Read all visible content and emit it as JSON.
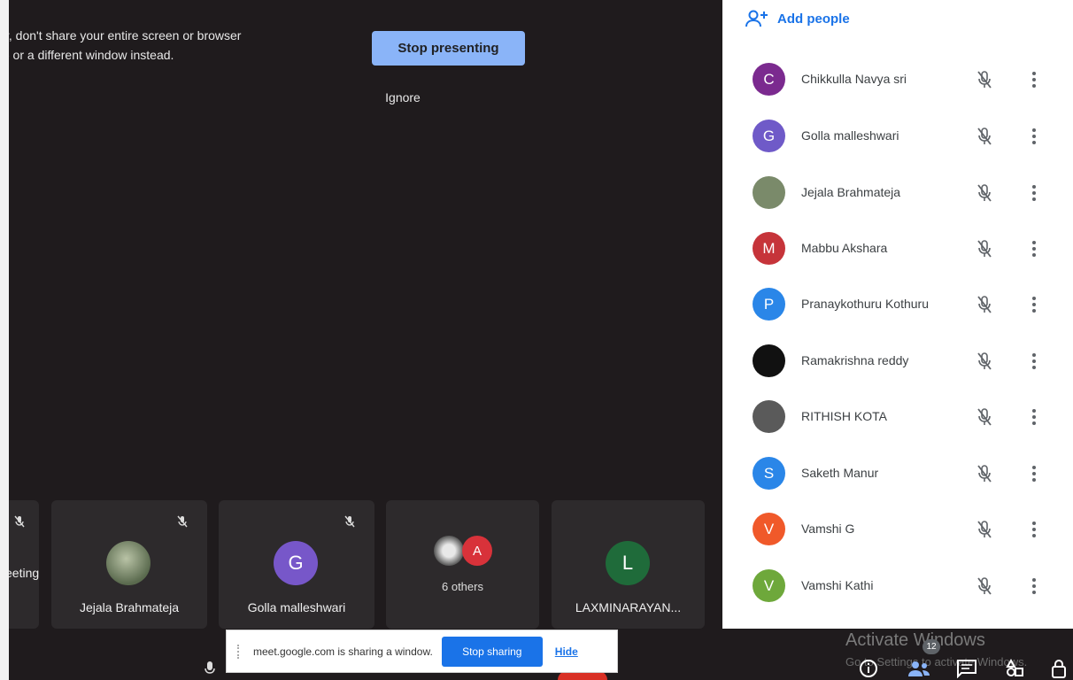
{
  "stage": {
    "warning_line1": "r, don't share your entire screen or browser",
    "warning_line2": "- or a different window instead.",
    "stop_presenting": "Stop presenting",
    "ignore": "Ignore"
  },
  "tiles": [
    {
      "name": "eeting"
    },
    {
      "name": "Jejala Brahmateja"
    },
    {
      "name": "Golla malleshwari",
      "initial": "G"
    },
    {
      "name": "6 others",
      "initial": "A"
    },
    {
      "name": "LAXMINARAYAN...",
      "initial": "L"
    }
  ],
  "share_bar": {
    "text": "meet.google.com is sharing a window.",
    "stop_sharing": "Stop sharing",
    "hide": "Hide"
  },
  "panel": {
    "add_people": "Add people",
    "people": [
      {
        "name": "Chikkulla Navya sri",
        "initial": "C",
        "color": "#7b2a8f"
      },
      {
        "name": "Golla malleshwari",
        "initial": "G",
        "color": "#6f5ac8"
      },
      {
        "name": "Jejala Brahmateja",
        "initial": "",
        "color": "#7a8a6a"
      },
      {
        "name": "Mabbu Akshara",
        "initial": "M",
        "color": "#c6343a"
      },
      {
        "name": "Pranaykothuru Kothuru",
        "initial": "P",
        "color": "#2a86e8"
      },
      {
        "name": "Ramakrishna reddy",
        "initial": "",
        "color": "#111111"
      },
      {
        "name": "RITHISH KOTA",
        "initial": "",
        "color": "#5a5a5a"
      },
      {
        "name": "Saketh Manur",
        "initial": "S",
        "color": "#2a86e8"
      },
      {
        "name": "Vamshi G",
        "initial": "V",
        "color": "#f0592a"
      },
      {
        "name": "Vamshi Kathi",
        "initial": "V",
        "color": "#6ea83b"
      }
    ]
  },
  "watermark": {
    "title": "Activate Windows",
    "subtitle": "Go to Settings to activate Windows."
  },
  "participants_badge": "12",
  "colors": {
    "accent": "#1a73e8",
    "stage_bg": "#1f1b1d",
    "tile_bg": "#2d2a2c",
    "present_btn": "#8ab4f8"
  }
}
